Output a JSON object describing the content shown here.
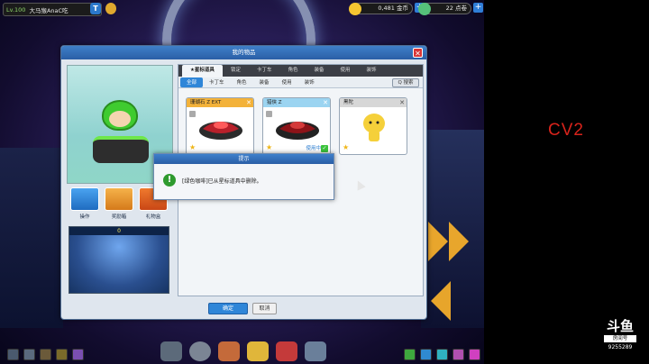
{
  "topbar": {
    "level": "Lv.100",
    "player_name": "大马猴AnaC吃",
    "t_badge": "T",
    "coins": "0,481 金币",
    "points": "22 点卷"
  },
  "modal": {
    "title": "我的物品",
    "close_icon": "close-icon",
    "tabs_main": [
      "★星标道具",
      "锁定",
      "卡丁车",
      "角色",
      "装备",
      "使用",
      "装饰"
    ],
    "tabs_sub": [
      "全部",
      "卡丁车",
      "角色",
      "装备",
      "使用",
      "装饰"
    ],
    "search_label": "Q 搜索",
    "left_actions": [
      {
        "label": "操作",
        "icon": "operate-icon"
      },
      {
        "label": "奖励箱",
        "icon": "reward-box-icon"
      },
      {
        "label": "礼物盒",
        "icon": "gift-box-icon"
      }
    ],
    "lower_panel_value": "0",
    "cards": [
      {
        "title": "珊瑚石 Z EXT",
        "status": "",
        "header_color": "#f3b23a"
      },
      {
        "title": "猎侠 Z",
        "status": "使用中",
        "header_color": "#9bd4f1"
      },
      {
        "title": "黑陀",
        "status": "",
        "header_color": "#d7d7d7"
      }
    ],
    "confirm_label": "确定",
    "cancel_label": "取消"
  },
  "dialog": {
    "title": "提示",
    "message": "[绿色咖啡]已从星标道具中删除。",
    "icon": "info-icon"
  },
  "overlay": {
    "cv_label": "CV2",
    "site_logo": "斗鱼",
    "room_label": "房间号",
    "room_number": "9255289"
  }
}
